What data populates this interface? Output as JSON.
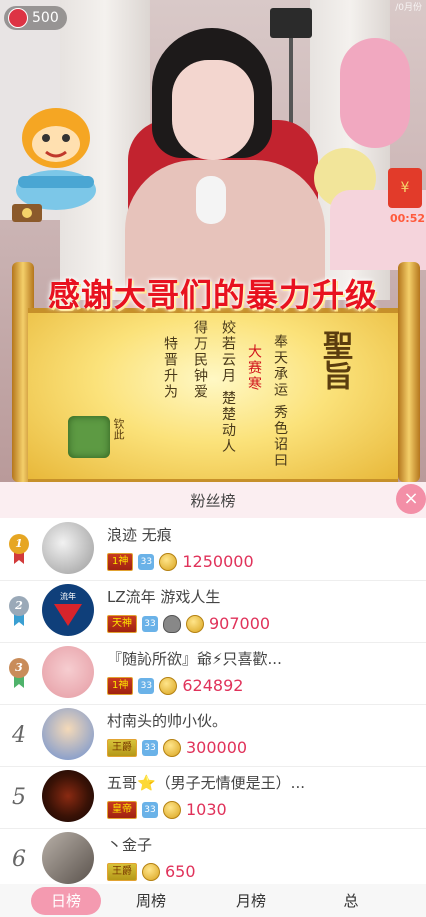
{
  "stream": {
    "viewer_count": "500",
    "corner_text": "/0月份",
    "redpack_icon": "red-envelope-icon",
    "redpack_timer": "00:52"
  },
  "banner": {
    "title": "感谢大哥们的暴力升级",
    "edict": "聖旨",
    "lines": [
      "奉天承运 秀色诏曰",
      "大赛寒",
      "姣若云月 楚楚动人",
      "得万民钟爱",
      "特晋升为"
    ],
    "seal": "钦此"
  },
  "panel": {
    "title": "粉丝榜",
    "close_label": "×",
    "fans": [
      {
        "rank": "1",
        "name": "浪迹 无痕",
        "rank_badge": "1神",
        "level": "33",
        "coins": "1250000",
        "medal_color": "#e6a623"
      },
      {
        "rank": "2",
        "name": "LZ流年 游戏人生",
        "rank_badge": "天神",
        "level": "33",
        "coins": "907000",
        "medal_color": "#9aa9b8"
      },
      {
        "rank": "3",
        "name": "『随訫所欲』爺⚡只喜歡...",
        "rank_badge": "1神",
        "level": "33",
        "coins": "624892",
        "medal_color": "#c98c5a"
      },
      {
        "rank": "4",
        "name": "村南头的帅小伙。",
        "rank_badge": "王爵",
        "level": "33",
        "coins": "300000"
      },
      {
        "rank": "5",
        "name": "五哥⭐（男子无情便是王）...",
        "rank_badge": "皇帝",
        "level": "33",
        "coins": "1030"
      },
      {
        "rank": "6",
        "name": "丶金子",
        "rank_badge": "王爵",
        "level": "",
        "coins": "650"
      }
    ],
    "tabs": [
      "日榜",
      "周榜",
      "月榜",
      "总"
    ]
  }
}
